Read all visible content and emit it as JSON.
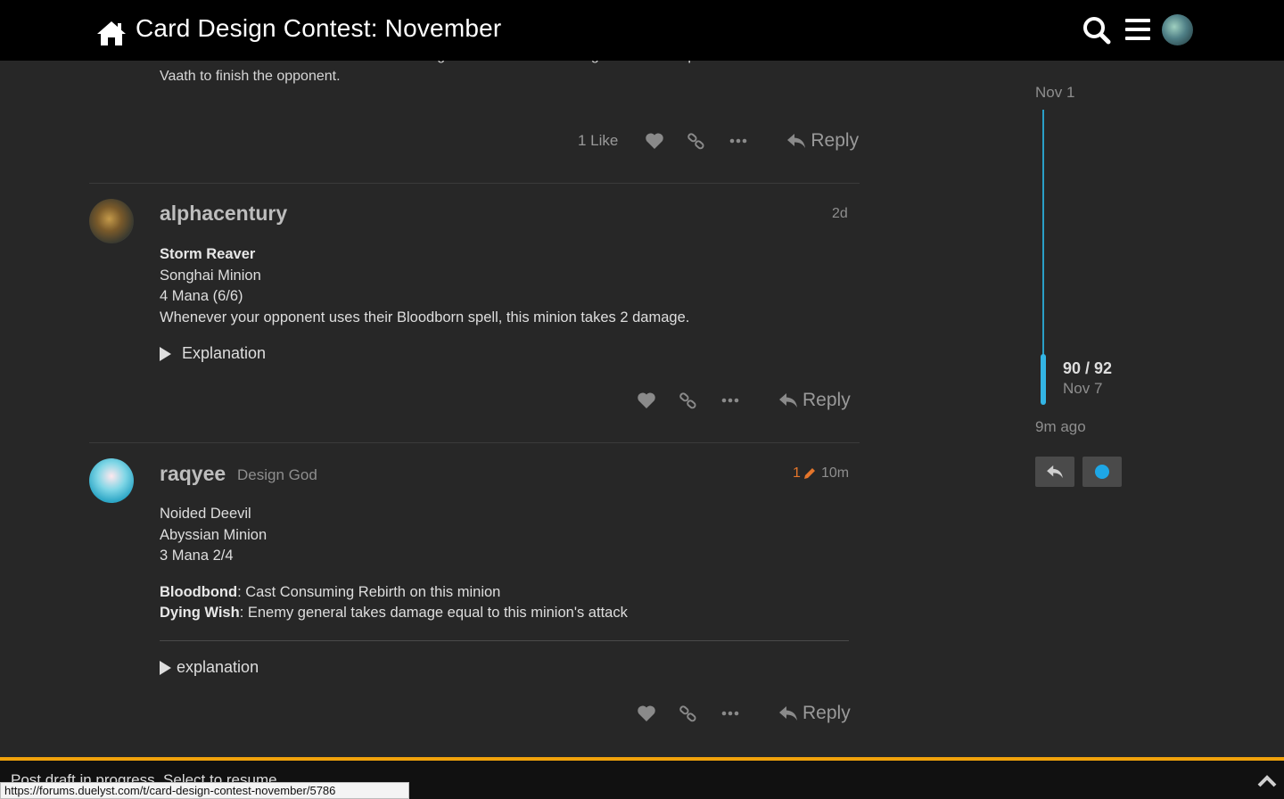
{
  "header": {
    "title": "Card Design Contest: November",
    "home_icon": "home-icon",
    "search_icon": "search-icon",
    "menu_icon": "hamburger-icon"
  },
  "previous_post": {
    "cutoff_line": "to remove a threat from the board in exchange for health. In the late game it can help an overloaded",
    "last_line": "Vaath to finish the opponent.",
    "like_count": "1 Like",
    "reply_label": "Reply"
  },
  "posts": [
    {
      "username": "alphacentury",
      "date": "2d",
      "card_name": "Storm Reaver",
      "lines": [
        "Songhai Minion",
        "4 Mana (6/6)",
        "Whenever your opponent uses their Bloodborn spell, this minion takes 2 damage."
      ],
      "details_label": "Explanation",
      "reply_label": "Reply"
    },
    {
      "username": "raqyee",
      "user_title": "Design God",
      "edit_count": "1",
      "date": "10m",
      "lines": [
        "Noided Deevil",
        "Abyssian Minion",
        "3 Mana 2/4"
      ],
      "ability1_keyword": "Bloodbond",
      "ability1_text": ": Cast Consuming Rebirth on this minion",
      "ability2_keyword": "Dying Wish",
      "ability2_text": ": Enemy general takes damage equal to this minion's attack",
      "details_label": "explanation",
      "reply_label": "Reply"
    }
  ],
  "timeline": {
    "start_date": "Nov 1",
    "position": "90 / 92",
    "position_date": "Nov 7",
    "end_label": "9m ago"
  },
  "draft": {
    "text": "Post draft in progress. Select to resume."
  },
  "status_url": "https://forums.duelyst.com/t/card-design-contest-november/5786",
  "colors": {
    "accent": "#33b5e5",
    "draft_border": "#f0a20b",
    "edit": "#e4752b"
  }
}
